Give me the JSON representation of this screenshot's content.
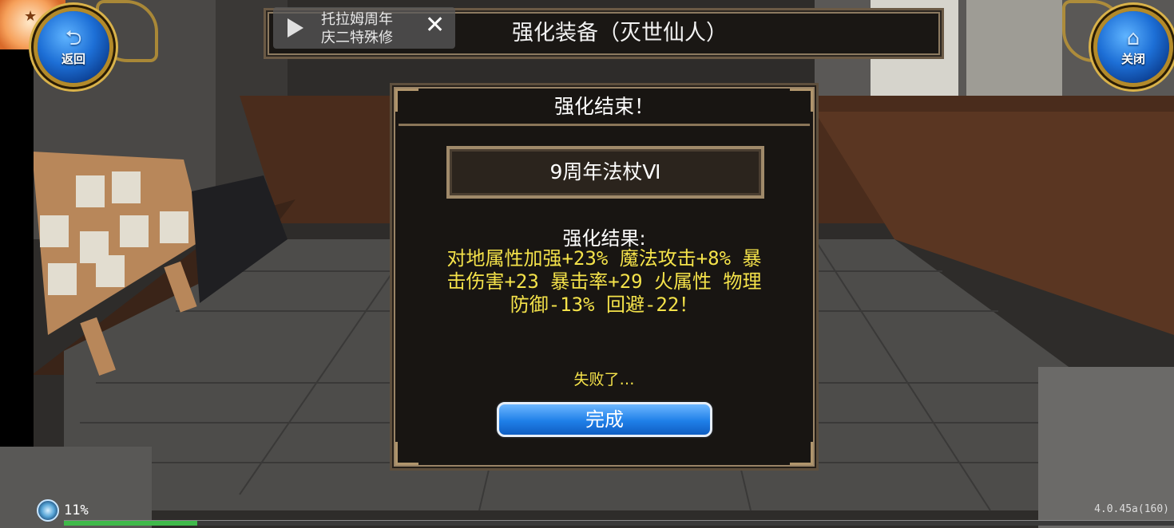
{
  "top_bar": {
    "back_label": "返回",
    "close_label": "关闭",
    "title": "强化装备（灭世仙人）"
  },
  "ad_overlay": {
    "line1": "托拉姆周年",
    "line2": "庆二特殊修",
    "close_glyph": "✕"
  },
  "dialog": {
    "header": "强化结束！",
    "item_name": "9周年法杖Ⅵ",
    "result_title": "强化结果:",
    "result_lines": [
      "对地属性加强+23% 魔法攻击+8% 暴",
      "击伤害+23 暴击率+29 火属性 物理",
      "防御-13% 回避-22！"
    ],
    "status_text": "失败了…",
    "done_label": "完成"
  },
  "footer": {
    "battery_percent": "11%",
    "version": "4.0.45a(160)",
    "progress": 0.12
  },
  "colors": {
    "highlight_text": "#f4e24a",
    "button_blue": "#1f7fe8",
    "progress_green": "#3fb94a"
  },
  "icons": {
    "back": "return-arrow-icon",
    "close": "home-icon",
    "ad_play": "play-icon",
    "ad_close": "close-icon"
  }
}
